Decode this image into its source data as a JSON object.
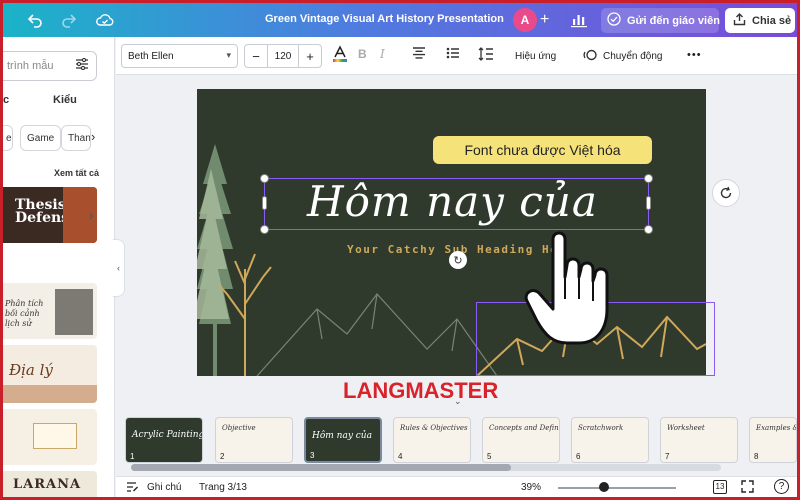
{
  "topbar": {
    "title": "Green Vintage Visual Art History Presentation",
    "avatar_letter": "A",
    "send_label": "Gửi đến giáo viên",
    "share_label": "Chia sẻ",
    "icons": [
      "undo-icon",
      "redo-icon",
      "cloud-saved-icon",
      "add-icon",
      "bar-chart-icon",
      "check-circle-icon",
      "upload-icon"
    ]
  },
  "left_panel": {
    "search_placeholder": "trình mẫu",
    "tab_left": "c",
    "tab_right": "Kiểu",
    "chips": [
      "e",
      "Game",
      "Thanh"
    ],
    "see_all": "Xem tất cả",
    "templates": [
      {
        "title": "Thesis Defense"
      },
      {
        "title": "Phân tích bối cảnh lịch sử"
      },
      {
        "title": "Địa lý"
      },
      {
        "title": ""
      },
      {
        "title": "LARANA"
      }
    ]
  },
  "toolbar": {
    "font": "Beth Ellen",
    "size": "120",
    "effects": "Hiệu ứng",
    "animate": "Chuyển động",
    "more": "•••"
  },
  "slide": {
    "title": "Hôm nay của",
    "subtitle": "Your Catchy Sub Heading He",
    "tooltip": "Font chưa được Việt hóa"
  },
  "watermark": "LANGMASTER",
  "pages": [
    {
      "num": "1",
      "title": "Acrylic Painting",
      "dark": true
    },
    {
      "num": "2",
      "title": "Objective",
      "dark": false
    },
    {
      "num": "3",
      "title": "Hôm nay của",
      "dark": true,
      "active": true
    },
    {
      "num": "4",
      "title": "Rules & Objectives",
      "dark": false
    },
    {
      "num": "5",
      "title": "Concepts and Definitions",
      "dark": false
    },
    {
      "num": "6",
      "title": "Scratchwork",
      "dark": false
    },
    {
      "num": "7",
      "title": "Worksheet",
      "dark": false
    },
    {
      "num": "8",
      "title": "Examples & Illustr",
      "dark": false
    }
  ],
  "statusbar": {
    "notes": "Ghi chú",
    "page": "Trang 3/13",
    "zoom": "39%",
    "zoom_fraction": 0.39,
    "pages_count": "13"
  },
  "colors": {
    "slide_bg": "#2f3a2d",
    "accent_gold": "#cfa85a",
    "selection": "#8a5cf6",
    "tooltip_bg": "#f5e37a",
    "brand_red": "#d8232a"
  }
}
